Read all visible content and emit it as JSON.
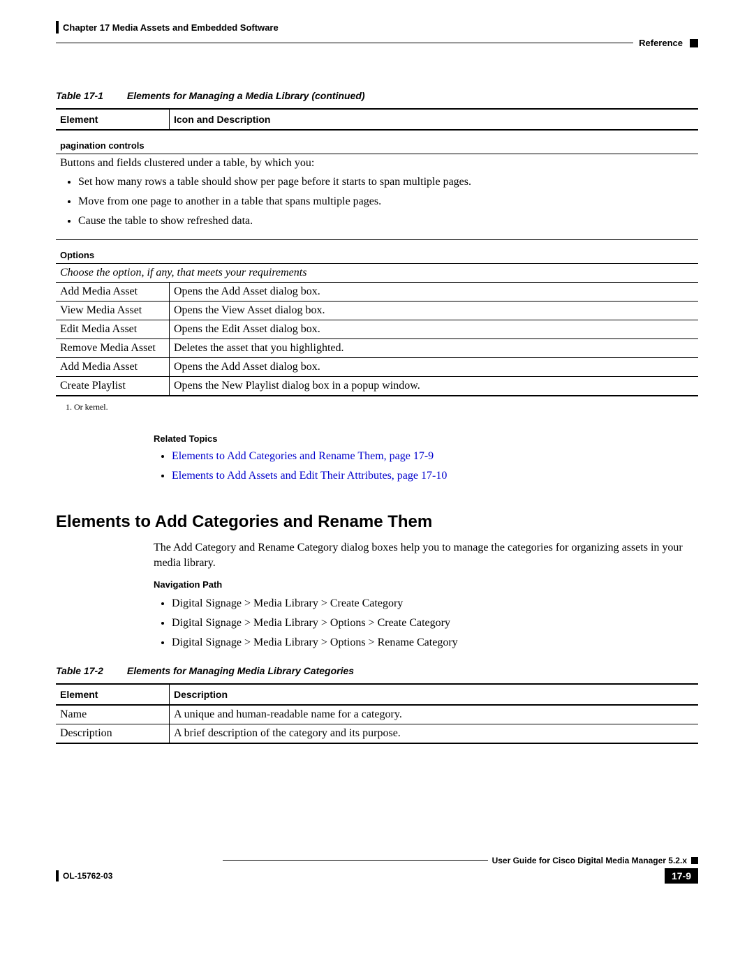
{
  "header": {
    "chapter": "Chapter 17    Media Assets and Embedded Software",
    "section": "Reference"
  },
  "table1": {
    "caption_label": "Table 17-1",
    "caption_title": "Elements for Managing a Media Library (continued)",
    "col1": "Element",
    "col2": "Icon and Description",
    "pagination_label": "pagination controls",
    "pagination_desc": "Buttons and fields clustered under a table, by which you:",
    "pagination_items": {
      "0": "Set how many rows a table should show per page before it starts to span multiple pages.",
      "1": "Move from one page to another in a table that spans multiple pages.",
      "2": "Cause the table to show refreshed data."
    },
    "options_label": "Options",
    "options_hint": "Choose the option, if any, that meets your requirements",
    "rows": {
      "0": {
        "e": "Add Media Asset",
        "d": "Opens the Add Asset dialog box."
      },
      "1": {
        "e": "View Media Asset",
        "d": "Opens the View Asset dialog box."
      },
      "2": {
        "e": "Edit Media Asset",
        "d": "Opens the Edit Asset dialog box."
      },
      "3": {
        "e": "Remove Media Asset",
        "d": "Deletes the asset that you highlighted."
      },
      "4": {
        "e": "Add Media Asset",
        "d": "Opens the Add Asset dialog box."
      },
      "5": {
        "e": "Create Playlist",
        "d": "Opens the New Playlist dialog box in a popup window."
      }
    },
    "footnote": "1.  Or kernel."
  },
  "related": {
    "label": "Related Topics",
    "items": {
      "0": "Elements to Add Categories and Rename Them, page 17-9",
      "1": "Elements to Add Assets and Edit Their Attributes, page 17-10"
    }
  },
  "section2": {
    "title": "Elements to Add Categories and Rename Them",
    "intro": "The Add Category and Rename Category dialog boxes help you to manage the categories for organizing assets in your media library.",
    "nav_label": "Navigation Path",
    "nav_items": {
      "0": "Digital Signage > Media Library > Create Category",
      "1": "Digital Signage > Media Library > Options > Create Category",
      "2": "Digital Signage > Media Library > Options > Rename Category"
    }
  },
  "table2": {
    "caption_label": "Table 17-2",
    "caption_title": "Elements for Managing Media Library Categories",
    "col1": "Element",
    "col2": "Description",
    "rows": {
      "0": {
        "e": "Name",
        "d": "A unique and human-readable name for a category."
      },
      "1": {
        "e": "Description",
        "d": "A brief description of the category and its purpose."
      }
    }
  },
  "footer": {
    "guide": "User Guide for Cisco Digital Media Manager 5.2.x",
    "doc": "OL-15762-03",
    "page": "17-9"
  }
}
